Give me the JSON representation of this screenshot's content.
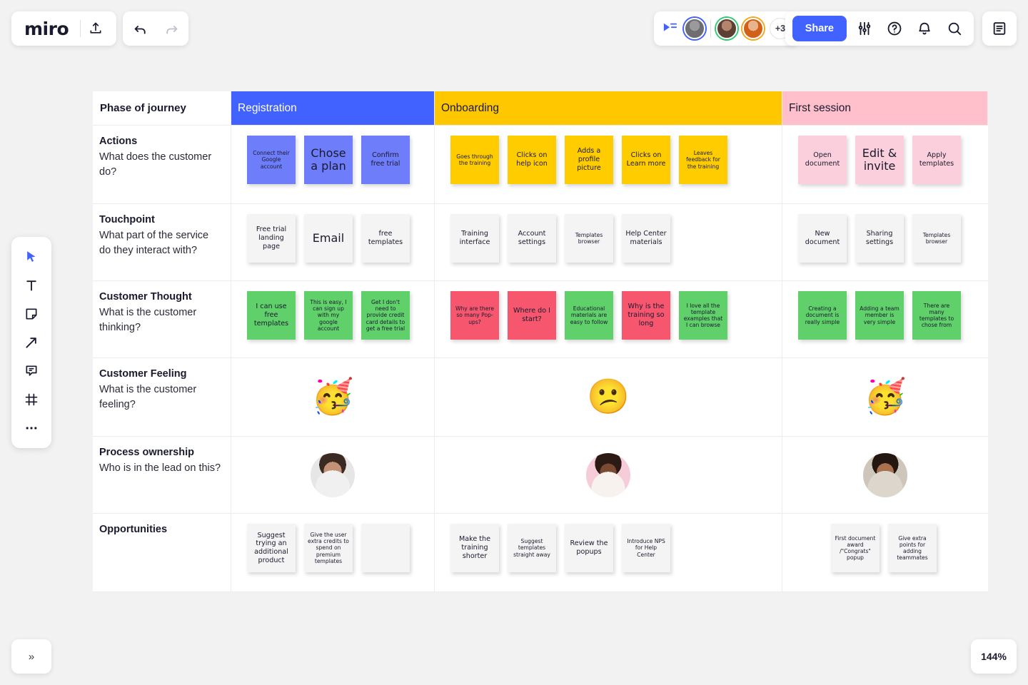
{
  "app": {
    "logo_text": "miro",
    "zoom_level": "144%",
    "collapse_label": "»"
  },
  "toolbar": {
    "upload_icon": "upload-icon",
    "undo_icon": "undo-icon",
    "redo_icon": "redo-icon",
    "cursor_share_icon": "cursor-share-icon",
    "share_label": "Share",
    "settings_icon": "sliders-icon",
    "help_icon": "help-circle-icon",
    "notifications_icon": "bell-icon",
    "search_icon": "search-icon",
    "notes_panel_icon": "document-panel-icon",
    "collaborator_overflow": "+3"
  },
  "tools": [
    {
      "name": "select-tool",
      "icon": "cursor-icon"
    },
    {
      "name": "text-tool",
      "icon": "text-icon"
    },
    {
      "name": "sticky-note-tool",
      "icon": "sticky-note-icon"
    },
    {
      "name": "arrow-tool",
      "icon": "arrow-icon"
    },
    {
      "name": "comment-tool",
      "icon": "comment-icon"
    },
    {
      "name": "frame-tool",
      "icon": "frame-icon"
    },
    {
      "name": "more-tools",
      "icon": "ellipsis-icon"
    }
  ],
  "board": {
    "corner_label": "Phase of journey",
    "phases": [
      {
        "label": "Registration",
        "color": "#4262ff"
      },
      {
        "label": "Onboarding",
        "color": "#ffc700"
      },
      {
        "label": "First session",
        "color": "#ffc0cb"
      }
    ],
    "rows": [
      {
        "title": "Actions",
        "subtitle": "What does the customer do?",
        "cells": [
          [
            {
              "text": "Connect their Google account",
              "color": "blue",
              "size": "s"
            },
            {
              "text": "Chose a plan",
              "color": "blue",
              "size": "l"
            },
            {
              "text": "Confirm free trial",
              "color": "blue",
              "size": "m"
            }
          ],
          [
            {
              "text": "Goes through the training",
              "color": "yellow",
              "size": "s"
            },
            {
              "text": "Clicks on help icon",
              "color": "yellow",
              "size": "m"
            },
            {
              "text": "Adds a profile picture",
              "color": "yellow",
              "size": "m"
            },
            {
              "text": "Clicks on Learn more",
              "color": "yellow",
              "size": "m"
            },
            {
              "text": "Leaves feedback for the training",
              "color": "yellow",
              "size": "s"
            }
          ],
          [
            {
              "text": "Open document",
              "color": "pink",
              "size": "m"
            },
            {
              "text": "Edit & invite",
              "color": "pink",
              "size": "l"
            },
            {
              "text": "Apply templates",
              "color": "pink",
              "size": "m"
            }
          ]
        ]
      },
      {
        "title": "Touchpoint",
        "subtitle": "What part of the service do they interact with?",
        "cells": [
          [
            {
              "text": "Free trial landing page",
              "color": "white",
              "size": "m"
            },
            {
              "text": "Email",
              "color": "white",
              "size": "l"
            },
            {
              "text": "free templates",
              "color": "white",
              "size": "m"
            }
          ],
          [
            {
              "text": "Training interface",
              "color": "white",
              "size": "m"
            },
            {
              "text": "Account settings",
              "color": "white",
              "size": "m"
            },
            {
              "text": "Templates browser",
              "color": "white",
              "size": "s"
            },
            {
              "text": "Help Center materials",
              "color": "white",
              "size": "m"
            }
          ],
          [
            {
              "text": "New document",
              "color": "white",
              "size": "m"
            },
            {
              "text": "Sharing settings",
              "color": "white",
              "size": "m"
            },
            {
              "text": "Templates browser",
              "color": "white",
              "size": "s"
            }
          ]
        ]
      },
      {
        "title": "Customer Thought",
        "subtitle": "What is the customer thinking?",
        "cells": [
          [
            {
              "text": "I can use free templates",
              "color": "green",
              "size": "m"
            },
            {
              "text": "This is easy, I can sign up with my google account",
              "color": "green",
              "size": "s"
            },
            {
              "text": "Get I don't need to provide credit card details to get a free trial",
              "color": "green",
              "size": "s"
            }
          ],
          [
            {
              "text": "Why are there so many Pop-ups?",
              "color": "red",
              "size": "s"
            },
            {
              "text": "Where do I start?",
              "color": "red",
              "size": "m"
            },
            {
              "text": "Educational materials are easy to follow",
              "color": "green",
              "size": "s"
            },
            {
              "text": "Why is the training so long",
              "color": "red",
              "size": "m"
            },
            {
              "text": "I love all the template examples that I can browse",
              "color": "green",
              "size": "s"
            }
          ],
          [
            {
              "text": "Creating a document is really simple",
              "color": "green",
              "size": "s"
            },
            {
              "text": "Adding a team member is very simple",
              "color": "green",
              "size": "s"
            },
            {
              "text": "There are many templates to chose from",
              "color": "green",
              "size": "s"
            }
          ]
        ]
      },
      {
        "title": "Customer Feeling",
        "subtitle": "What is the customer feeling?",
        "emojis": [
          "🥳",
          "😕",
          "🥳"
        ]
      },
      {
        "title": "Process ownership",
        "subtitle": "Who is in the lead on this?",
        "avatars": [
          "owner-registration-photo",
          "owner-onboarding-photo",
          "owner-first-session-photo"
        ]
      },
      {
        "title": "Opportunities",
        "subtitle": "",
        "cells": [
          [
            {
              "text": "Suggest trying an additional product",
              "color": "white",
              "size": "m"
            },
            {
              "text": "Give the user extra credits to spend on premium templates",
              "color": "white",
              "size": "s"
            },
            {
              "text": "",
              "color": "white",
              "size": "m"
            }
          ],
          [
            {
              "text": "Make the training shorter",
              "color": "white",
              "size": "m"
            },
            {
              "text": "Suggest templates straight away",
              "color": "white",
              "size": "s"
            },
            {
              "text": "Review the popups",
              "color": "white",
              "size": "m"
            },
            {
              "text": "Introduce NPS for Help Center",
              "color": "white",
              "size": "s"
            }
          ],
          [
            {
              "text": "First document award /\"Congrats\" popup",
              "color": "white",
              "size": "s",
              "offset": 46
            },
            {
              "text": "Give extra points for adding teammates",
              "color": "white",
              "size": "s"
            }
          ]
        ]
      }
    ]
  }
}
